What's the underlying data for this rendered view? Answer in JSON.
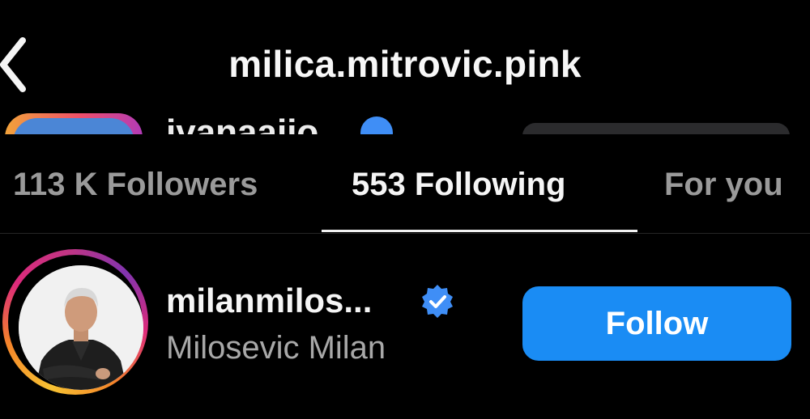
{
  "header": {
    "title": "milica.mitrovic.pink",
    "back_icon": "chevron-left-icon"
  },
  "peek_row": {
    "name_partial": "ivanaaiio"
  },
  "tabs": [
    {
      "label": "113 K Followers",
      "active": false
    },
    {
      "label": "553 Following",
      "active": true
    },
    {
      "label": "For you",
      "active": false
    }
  ],
  "list": [
    {
      "username": "milanmilos...",
      "full_name": "Milosevic Milan",
      "verified": true,
      "button_label": "Follow"
    }
  ],
  "colors": {
    "background": "#000000",
    "follow_button": "#1a8cf4",
    "verified_badge": "#3f8ef6",
    "inactive_tab": "#9a9a9a"
  }
}
